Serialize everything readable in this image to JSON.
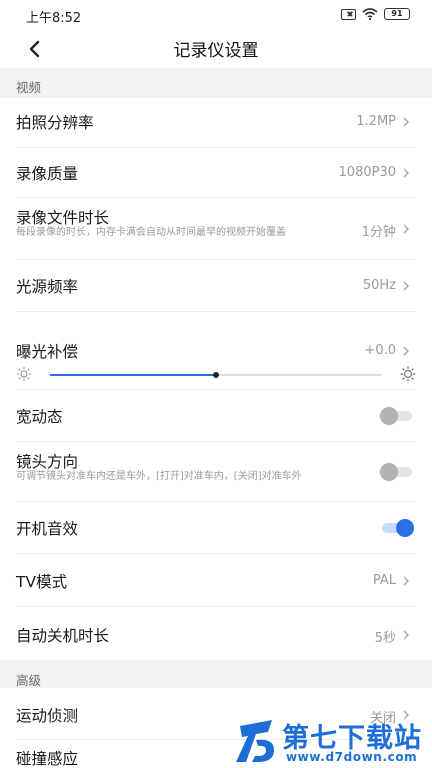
{
  "status_bar": {
    "time": "上午8:52",
    "battery": "91"
  },
  "nav": {
    "title": "记录仪设置"
  },
  "sections": {
    "video": "视频",
    "advanced": "高级"
  },
  "rows": {
    "photo_resolution": {
      "title": "拍照分辨率",
      "value": "1.2MP"
    },
    "video_quality": {
      "title": "录像质量",
      "value": "1080P30"
    },
    "video_duration": {
      "title": "录像文件时长",
      "subtitle": "每段录像的时长，内存卡满会自动从时间最早的视频开始覆盖",
      "value": "1分钟"
    },
    "light_frequency": {
      "title": "光源频率",
      "value": "50Hz"
    },
    "exposure": {
      "title": "曝光补偿",
      "value": "+0.0",
      "slider_fraction": 0.5
    },
    "wdr": {
      "title": "宽动态",
      "on": false
    },
    "lens_direction": {
      "title": "镜头方向",
      "subtitle": "可调节镜头对准车内还是车外，[打开]对准车内，[关闭]对准车外",
      "on": false
    },
    "boot_sound": {
      "title": "开机音效",
      "on": true
    },
    "tv_mode": {
      "title": "TV模式",
      "value": "PAL"
    },
    "auto_shutdown": {
      "title": "自动关机时长",
      "value": "5秒"
    },
    "motion_detect": {
      "title": "运动侦测",
      "value": "关闭"
    },
    "collision": {
      "title": "碰撞感应"
    }
  },
  "watermark": {
    "title": "第七下载站",
    "url": "www.d7down.com"
  },
  "colors": {
    "accent": "#2a6ee8",
    "watermark": "#1d6fd6"
  }
}
